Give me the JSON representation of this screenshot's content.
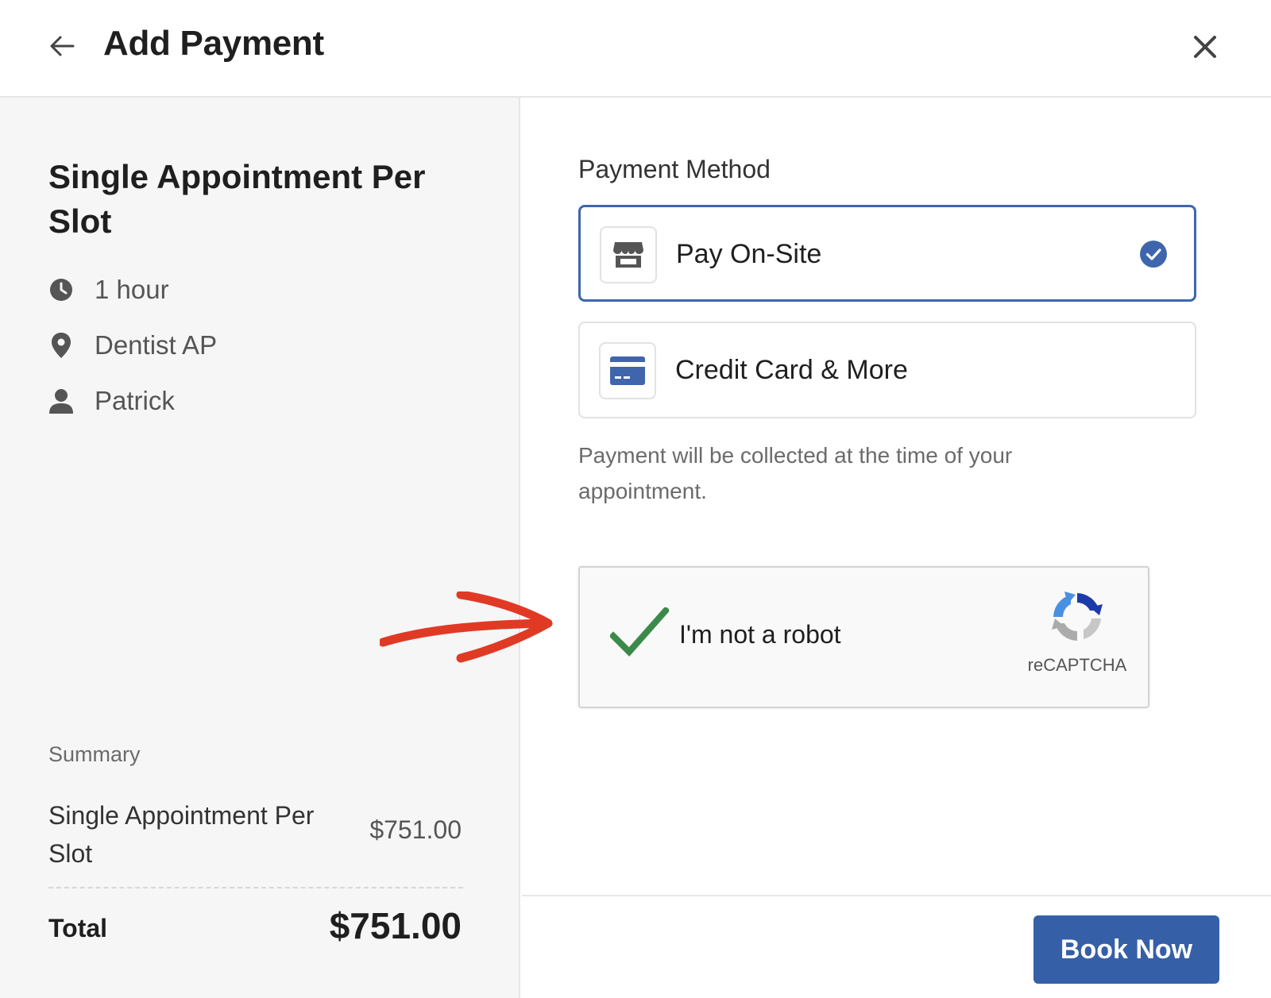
{
  "header": {
    "title": "Add Payment",
    "back_icon": "arrow-left-icon",
    "close_icon": "close-icon"
  },
  "service": {
    "title": "Single Appointment Per Slot",
    "details": [
      {
        "icon": "clock-icon",
        "text": "1 hour"
      },
      {
        "icon": "location-pin-icon",
        "text": "Dentist AP"
      },
      {
        "icon": "person-icon",
        "text": "Patrick"
      }
    ]
  },
  "summary": {
    "label": "Summary",
    "item_name": "Single Appointment Per Slot",
    "item_price": "$751.00",
    "total_label": "Total",
    "total_price": "$751.00"
  },
  "payment": {
    "label": "Payment Method",
    "options": [
      {
        "label": "Pay On-Site",
        "icon": "storefront-icon",
        "selected": true
      },
      {
        "label": "Credit Card & More",
        "icon": "credit-card-icon",
        "selected": false
      }
    ],
    "note": "Payment will be collected at the time of your appointment."
  },
  "recaptcha": {
    "label": "I'm not a robot",
    "brand": "reCAPTCHA",
    "checked": true
  },
  "footer": {
    "book_label": "Book Now"
  },
  "colors": {
    "accent": "#3560a8",
    "selected_border": "#3f66ad",
    "check_green": "#3b8a4a",
    "annotation_red": "#e03a25",
    "left_panel_bg": "#f6f6f6"
  }
}
